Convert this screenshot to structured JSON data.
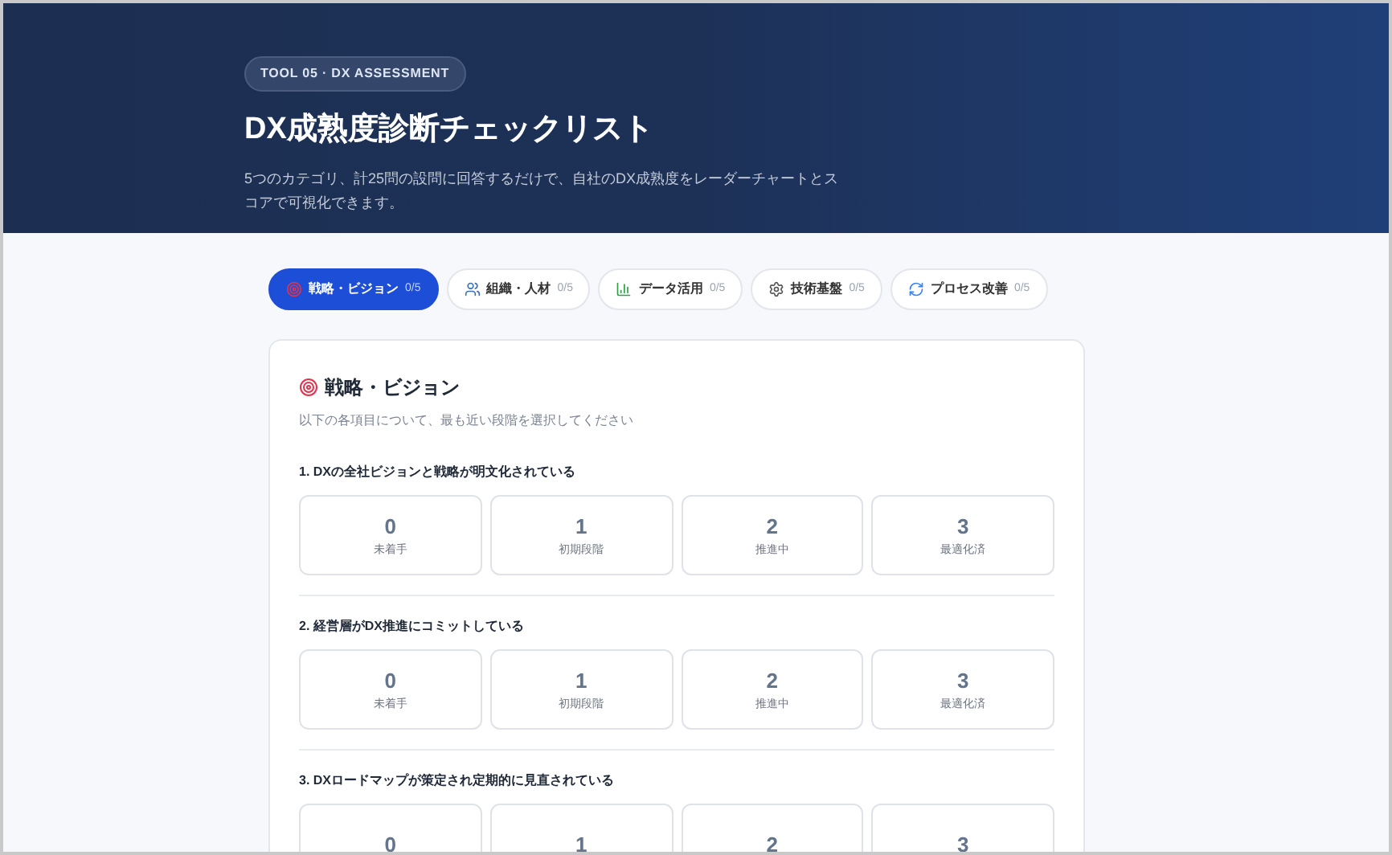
{
  "header": {
    "badge": "TOOL 05 · DX ASSESSMENT",
    "title": "DX成熟度診断チェックリスト",
    "description": "5つのカテゴリ、計25問の設問に回答するだけで、自社のDX成熟度をレーダーチャートとスコアで可視化できます。"
  },
  "tabs": [
    {
      "kind": "target",
      "label": "戦略・ビジョン",
      "count": "0/5",
      "selected": true
    },
    {
      "kind": "people",
      "label": "組織・人材",
      "count": "0/5",
      "selected": false
    },
    {
      "kind": "chart",
      "label": "データ活用",
      "count": "0/5",
      "selected": false
    },
    {
      "kind": "gear",
      "label": "技術基盤",
      "count": "0/5",
      "selected": false
    },
    {
      "kind": "cycle",
      "label": "プロセス改善",
      "count": "0/5",
      "selected": false
    }
  ],
  "section": {
    "kind": "target",
    "title": "戦略・ビジョン",
    "subtitle": "以下の各項目について、最も近い段階を選択してください"
  },
  "questions": [
    {
      "text": "1. DXの全社ビジョンと戦略が明文化されている",
      "options": [
        {
          "score": "0",
          "label": "未着手",
          "selected": false
        },
        {
          "score": "1",
          "label": "初期段階",
          "selected": false
        },
        {
          "score": "2",
          "label": "推進中",
          "selected": false
        },
        {
          "score": "3",
          "label": "最適化済",
          "selected": false
        }
      ]
    },
    {
      "text": "2. 経営層がDX推進にコミットしている",
      "options": [
        {
          "score": "0",
          "label": "未着手",
          "selected": false
        },
        {
          "score": "1",
          "label": "初期段階",
          "selected": false
        },
        {
          "score": "2",
          "label": "推進中",
          "selected": false
        },
        {
          "score": "3",
          "label": "最適化済",
          "selected": false
        }
      ]
    },
    {
      "text": "3. DXロードマップが策定され定期的に見直されている",
      "options": [
        {
          "score": "0",
          "selected": false
        },
        {
          "score": "1",
          "selected": false
        },
        {
          "score": "2",
          "selected": false
        },
        {
          "score": "3",
          "selected": false
        }
      ]
    }
  ]
}
